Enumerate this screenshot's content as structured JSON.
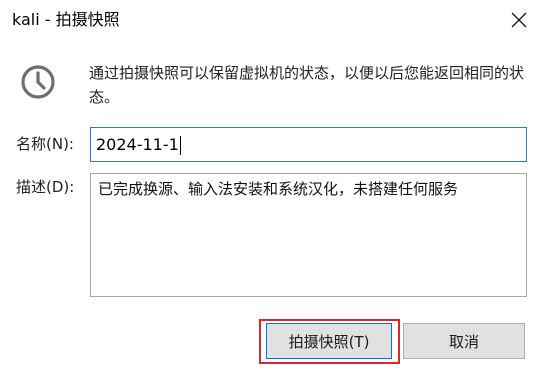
{
  "window": {
    "title": "kali - 拍摄快照",
    "close_icon": "close-icon"
  },
  "intro": {
    "icon": "clock-icon",
    "text": "通过拍摄快照可以保留虚拟机的状态，以便以后您能返回相同的状态。"
  },
  "form": {
    "name_label": "名称(N):",
    "name_value": "2024-11-1",
    "description_label": "描述(D):",
    "description_value": "已完成换源、输入法安装和系统汉化，未搭建任何服务"
  },
  "buttons": {
    "snapshot_label": "拍摄快照(T)",
    "cancel_label": "取消"
  },
  "colors": {
    "focus_border": "#0078d7",
    "highlight_ring": "#e0262d",
    "button_face": "#e1e1e1",
    "icon_gray": "#6e6e6e"
  }
}
